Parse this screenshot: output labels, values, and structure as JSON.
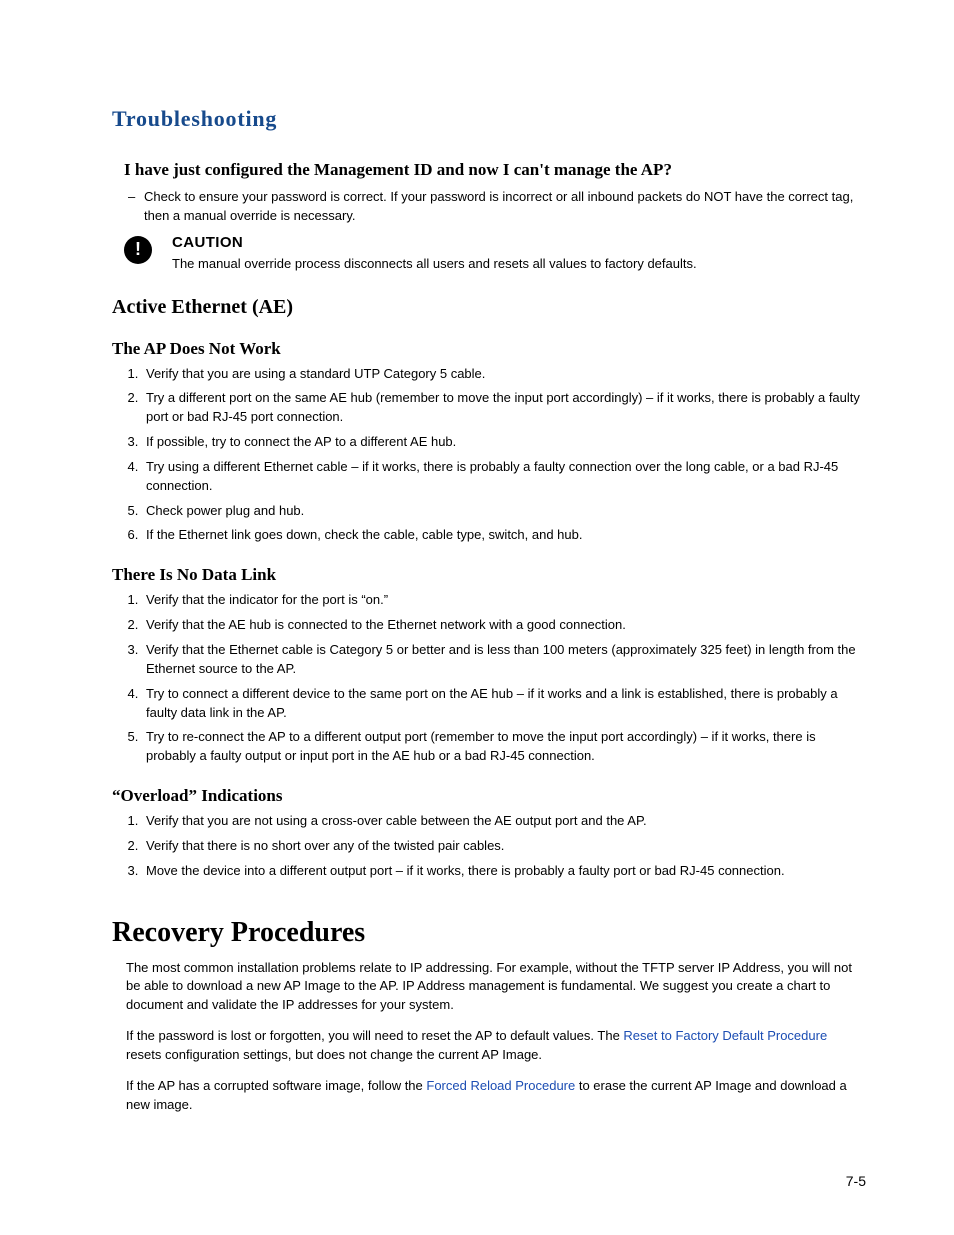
{
  "title_blue": "Troubleshooting",
  "faq_heading": "I have just configured the Management ID and now I can't manage the AP?",
  "faq_bullet": "Check to ensure your password is correct. If your password is incorrect or all inbound packets do NOT have the correct tag, then a manual override is necessary.",
  "caution_label": "CAUTION",
  "caution_body": "The manual override process disconnects all users and resets all values to factory defaults.",
  "ae_heading": "Active Ethernet (AE)",
  "ae_sub1": "The AP Does Not Work",
  "ae_sub1_items": [
    "Verify that you are using a standard UTP Category 5 cable.",
    "Try a different port on the same AE hub (remember to move the input port accordingly) – if it works, there is probably a faulty port or bad RJ-45 port connection.",
    "If possible, try to connect the AP to a different AE hub.",
    "Try using a different Ethernet cable – if it works, there is probably a faulty connection over the long cable, or a bad RJ-45 connection.",
    "Check power plug and hub.",
    "If the Ethernet link goes down, check the cable, cable type, switch, and hub."
  ],
  "ae_sub2": "There Is No Data Link",
  "ae_sub2_items": [
    "Verify that the indicator for the port is “on.”",
    "Verify that the AE hub is connected to the Ethernet network with a good connection.",
    "Verify that the Ethernet cable is Category 5 or better and is less than 100 meters (approximately 325 feet) in length from the Ethernet source to the AP.",
    "Try to connect a different device to the same port on the AE hub – if it works and a link is established, there is probably a faulty data link in the AP.",
    "Try to re-connect the AP to a different output port (remember to move the input port accordingly) – if it works, there is probably a faulty output or input port in the AE hub or a bad RJ-45 connection."
  ],
  "ae_sub3": "“Overload” Indications",
  "ae_sub3_items": [
    "Verify that you are not using a cross-over cable between the AE output port and the AP.",
    "Verify that there is no short over any of the twisted pair cables.",
    "Move the device into a different output port – if it works, there is probably a faulty port or bad RJ-45 connection."
  ],
  "recovery_heading": "Recovery Procedures",
  "recovery_p1": "The most common installation problems relate to IP addressing. For example, without the TFTP server IP Address, you will not be able to download a new AP Image to the AP. IP Address management is fundamental. We suggest you create a chart to document and validate the IP addresses for your system.",
  "recovery_p2_pre": "If the password is lost or forgotten, you will need to reset the AP to default values. The ",
  "recovery_p2_link": "Reset to Factory Default Procedure",
  "recovery_p2_post": " resets configuration settings, but does not change the current AP Image.",
  "recovery_p3_pre": "If the AP has a corrupted software image, follow the ",
  "recovery_p3_link": "Forced Reload Procedure",
  "recovery_p3_post": " to erase the current AP Image and download a new image.",
  "page_number": "7-5"
}
